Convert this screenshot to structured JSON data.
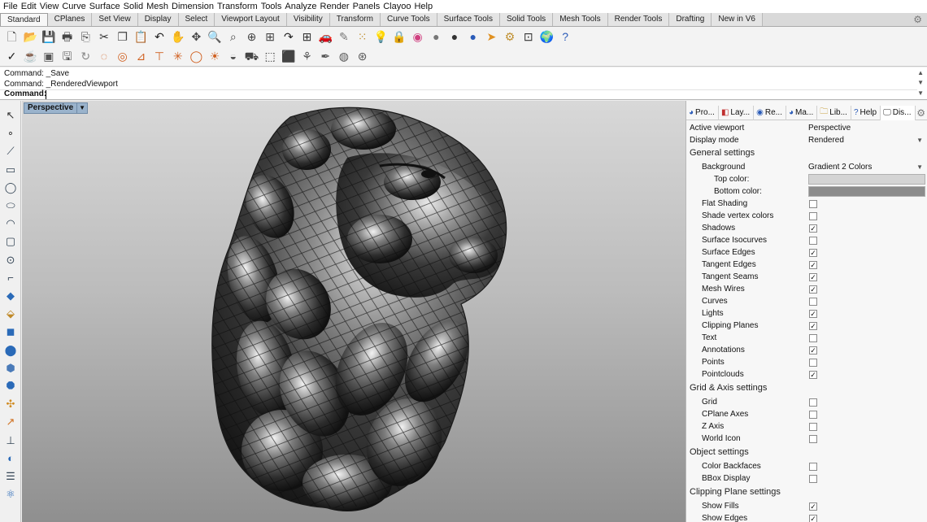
{
  "menubar": [
    "File",
    "Edit",
    "View",
    "Curve",
    "Surface",
    "Solid",
    "Mesh",
    "Dimension",
    "Transform",
    "Tools",
    "Analyze",
    "Render",
    "Panels",
    "Clayoo",
    "Help"
  ],
  "tabs": [
    "Standard",
    "CPlanes",
    "Set View",
    "Display",
    "Select",
    "Viewport Layout",
    "Visibility",
    "Transform",
    "Curve Tools",
    "Surface Tools",
    "Solid Tools",
    "Mesh Tools",
    "Render Tools",
    "Drafting",
    "New in V6"
  ],
  "active_tab": "Standard",
  "toolbar1_icons": [
    "new-file",
    "open-folder",
    "save",
    "print",
    "import",
    "cut",
    "copy",
    "paste",
    "undo",
    "pan",
    "rotate-view",
    "zoom",
    "zoom-window",
    "zoom-selected",
    "zoom-extents",
    "redo-view",
    "four-viewports",
    "car-render",
    "brush",
    "select-points",
    "bulb",
    "lock",
    "color-wheel",
    "sphere-gray",
    "sphere-dark",
    "sphere-blue",
    "pointer-arrow",
    "gears",
    "grid-snap",
    "globe",
    "help"
  ],
  "toolbar2_icons": [
    "circle-check",
    "teapot",
    "render-preview",
    "save-render",
    "rotate-3d",
    "lasso",
    "target",
    "protractor",
    "t-square",
    "sun-burst",
    "ring",
    "sun",
    "shadow",
    "car",
    "box",
    "box-alt",
    "plant",
    "brush-alt",
    "sphere-grid",
    "materials-ball"
  ],
  "command": {
    "history": [
      "Command: _Save",
      "Command: _RenderedViewport"
    ],
    "prompt_label": "Command:",
    "value": ""
  },
  "left_toolbar_icons": [
    "select-arrow",
    "point",
    "polyline",
    "rectangle",
    "circle",
    "ellipse",
    "arc",
    "rectangle-alt",
    "curve-point",
    "curve-fillet",
    "surface-patch",
    "surface-extrude",
    "solid-box",
    "solid-sphere",
    "mesh",
    "mesh-alt",
    "transform",
    "analyze-arrow",
    "dimension",
    "boolean",
    "layers",
    "gizmo"
  ],
  "viewport": {
    "label": "Perspective",
    "background_top": "#d8d8d8",
    "background_bottom": "#8f8f8f"
  },
  "panel": {
    "tabs": [
      {
        "icon": "properties-icon",
        "label": "Pro..."
      },
      {
        "icon": "layers-icon",
        "label": "Lay..."
      },
      {
        "icon": "render-icon",
        "label": "Re..."
      },
      {
        "icon": "materials-icon",
        "label": "Ma..."
      },
      {
        "icon": "library-icon",
        "label": "Lib..."
      },
      {
        "icon": "help-icon",
        "label": "Help"
      },
      {
        "icon": "display-icon",
        "label": "Dis..."
      }
    ],
    "active_viewport_label": "Active viewport",
    "active_viewport_value": "Perspective",
    "display_mode_label": "Display mode",
    "display_mode_value": "Rendered",
    "general_settings": "General settings",
    "background_label": "Background",
    "background_value": "Gradient 2 Colors",
    "top_color_label": "Top color:",
    "top_color": "#d4d4d4",
    "bottom_color_label": "Bottom color:",
    "bottom_color": "#8c8c8c",
    "general_checks": [
      {
        "label": "Flat Shading",
        "checked": false
      },
      {
        "label": "Shade vertex colors",
        "checked": false
      },
      {
        "label": "Shadows",
        "checked": true
      },
      {
        "label": "Surface Isocurves",
        "checked": false
      },
      {
        "label": "Surface Edges",
        "checked": true
      },
      {
        "label": "Tangent Edges",
        "checked": true
      },
      {
        "label": "Tangent Seams",
        "checked": true
      },
      {
        "label": "Mesh Wires",
        "checked": true
      },
      {
        "label": "Curves",
        "checked": false
      },
      {
        "label": "Lights",
        "checked": true
      },
      {
        "label": "Clipping Planes",
        "checked": true
      },
      {
        "label": "Text",
        "checked": false
      },
      {
        "label": "Annotations",
        "checked": true
      },
      {
        "label": "Points",
        "checked": false
      },
      {
        "label": "Pointclouds",
        "checked": true
      }
    ],
    "grid_settings": "Grid & Axis settings",
    "grid_checks": [
      {
        "label": "Grid",
        "checked": false
      },
      {
        "label": "CPlane Axes",
        "checked": false
      },
      {
        "label": "Z Axis",
        "checked": false
      },
      {
        "label": "World Icon",
        "checked": false
      }
    ],
    "object_settings": "Object settings",
    "object_checks": [
      {
        "label": "Color Backfaces",
        "checked": false
      },
      {
        "label": "BBox Display",
        "checked": false
      }
    ],
    "clipping_settings": "Clipping Plane settings",
    "clipping_checks": [
      {
        "label": "Show Fills",
        "checked": true
      },
      {
        "label": "Show Edges",
        "checked": true
      }
    ]
  }
}
